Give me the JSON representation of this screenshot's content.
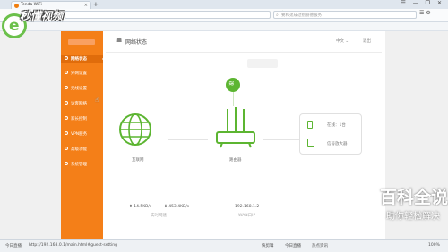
{
  "browser": {
    "tab_title": "Tenda WiFi",
    "new_tab": "+",
    "search_placeholder": "要和弟成过别丽德服务",
    "bookmark_icon": "star-icon",
    "window_controls": "☰ — ❐ ✕"
  },
  "watermark": {
    "logo_text": "秒懂视频",
    "baidu_title": "百科全说",
    "baidu_sub": "助你轻松解决"
  },
  "header": {
    "title": "网络状态",
    "language": "中文 ⌄",
    "exit": "退出"
  },
  "sidebar": {
    "items": [
      {
        "label": "网络状态",
        "active": true
      },
      {
        "label": "外网设置"
      },
      {
        "label": "无线设置"
      },
      {
        "label": "访客网络"
      },
      {
        "label": "家长控制"
      },
      {
        "label": "VPN服务"
      },
      {
        "label": "高级功能"
      },
      {
        "label": "系统管理"
      }
    ]
  },
  "topology": {
    "internet_label": "互联网",
    "router_label": "路由器",
    "online_label": "在线：1台",
    "booster_label": "信号放大器"
  },
  "stats": {
    "upload": "⬆ 14.5KB/s",
    "download": "⬇ 453.4KB/s",
    "speed_label": "实时网速",
    "wan_ip": "192.168.1.2",
    "wan_ip_label": "WAN口IP"
  },
  "statusbar": {
    "url": "http://192.168.0.1/main.html#guest-setting",
    "left_label": "今日直播",
    "items": [
      "快剪辑",
      "今日直播",
      "热点资讯"
    ],
    "zoom": "100%"
  },
  "colors": {
    "sidebar": "#f47f18",
    "accent_green": "#5cb531"
  }
}
